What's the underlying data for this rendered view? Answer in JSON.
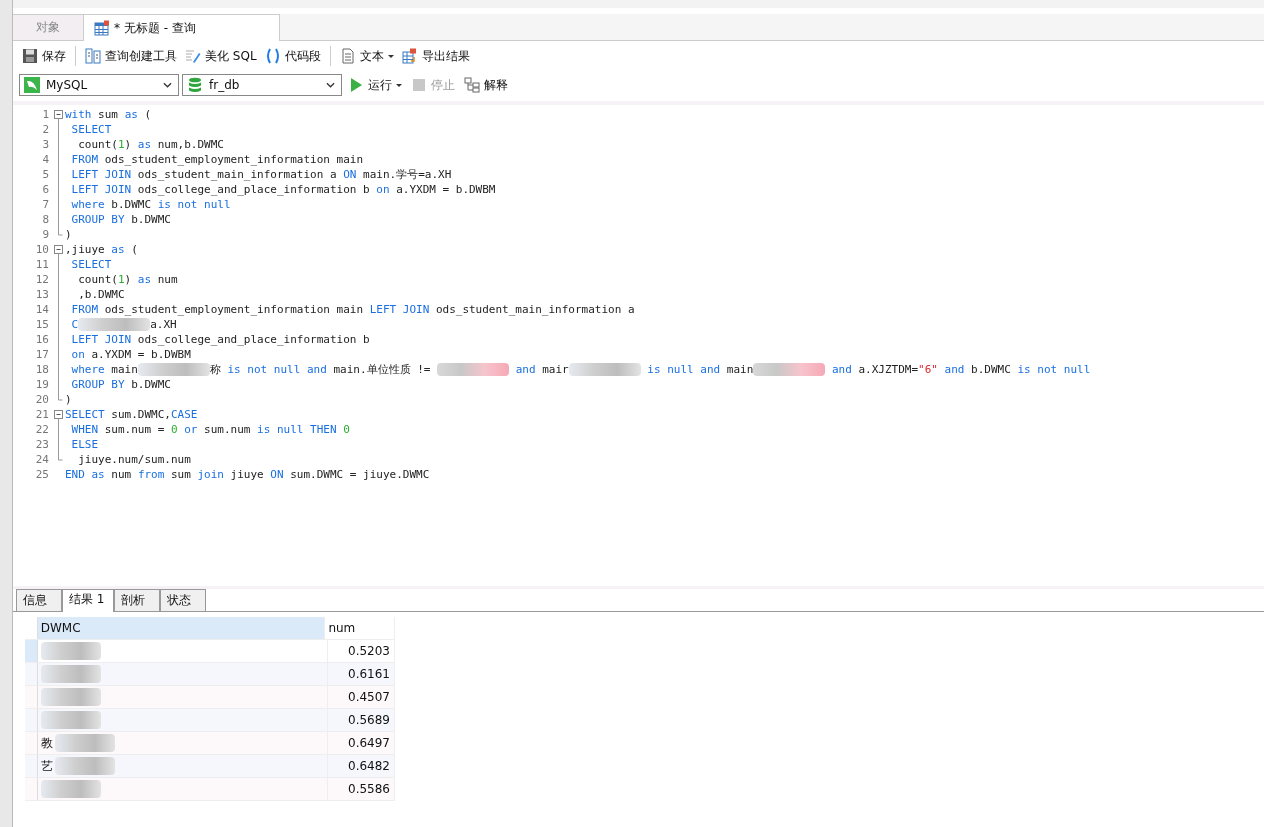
{
  "tabs": [
    {
      "label": "对象",
      "selected": false,
      "kind": "plain"
    },
    {
      "label": "* 无标题 - 查询",
      "selected": true,
      "kind": "query"
    }
  ],
  "toolbar": [
    {
      "label": "保存",
      "kind": "save"
    },
    {
      "label": "查询创建工具",
      "kind": "builder"
    },
    {
      "label": "美化 SQL",
      "kind": "beautify"
    },
    {
      "label": "代码段",
      "kind": "snippet"
    },
    {
      "label": "文本",
      "kind": "text",
      "dropdown": true
    },
    {
      "label": "导出结果",
      "kind": "export"
    }
  ],
  "connection": {
    "value": "MySQL"
  },
  "database": {
    "value": "fr_db"
  },
  "actions": [
    {
      "label": "运行",
      "kind": "run",
      "dropdown": true,
      "disabled": false
    },
    {
      "label": "停止",
      "kind": "stop",
      "disabled": true
    },
    {
      "label": "解释",
      "kind": "explain",
      "disabled": false
    }
  ],
  "code_lines": [
    {
      "number": "1",
      "kind": "fold_start",
      "tokens": [
        {
          "kind": "kw",
          "t": "with"
        },
        {
          "kind": "id",
          "t": " sum "
        },
        {
          "kind": "kw",
          "t": "as"
        },
        {
          "kind": "id",
          "t": " ("
        }
      ]
    },
    {
      "number": "2",
      "tokens": [
        {
          "kind": "kw",
          "t": " SELECT"
        }
      ]
    },
    {
      "number": "3",
      "tokens": [
        {
          "kind": "id",
          "t": "  count("
        },
        {
          "kind": "num",
          "t": "1"
        },
        {
          "kind": "id",
          "t": ") "
        },
        {
          "kind": "kw",
          "t": "as"
        },
        {
          "kind": "id",
          "t": " num,b.DWMC"
        }
      ]
    },
    {
      "number": "4",
      "tokens": [
        {
          "kind": "kw",
          "t": " FROM"
        },
        {
          "kind": "id",
          "t": " ods_student_employment_information main"
        }
      ]
    },
    {
      "number": "5",
      "tokens": [
        {
          "kind": "kw",
          "t": " LEFT JOIN"
        },
        {
          "kind": "id",
          "t": " ods_student_main_information a "
        },
        {
          "kind": "kw",
          "t": "ON"
        },
        {
          "kind": "id",
          "t": " main.学号=a.XH"
        }
      ]
    },
    {
      "number": "6",
      "tokens": [
        {
          "kind": "kw",
          "t": " LEFT JOIN"
        },
        {
          "kind": "id",
          "t": " ods_college_and_place_information b "
        },
        {
          "kind": "kw",
          "t": "on"
        },
        {
          "kind": "id",
          "t": " a.YXDM = b.DWBM"
        }
      ]
    },
    {
      "number": "7",
      "tokens": [
        {
          "kind": "kw",
          "t": " where"
        },
        {
          "kind": "id",
          "t": " b.DWMC "
        },
        {
          "kind": "kw",
          "t": "is not null"
        }
      ]
    },
    {
      "number": "8",
      "tokens": [
        {
          "kind": "kw",
          "t": " GROUP BY"
        },
        {
          "kind": "id",
          "t": " b.DWMC"
        }
      ]
    },
    {
      "number": "9",
      "kind": "fold_end",
      "tokens": [
        {
          "kind": "id",
          "t": ")"
        }
      ]
    },
    {
      "number": "10",
      "kind": "fold_start",
      "tokens": [
        {
          "kind": "id",
          "t": ",jiuye "
        },
        {
          "kind": "kw",
          "t": "as"
        },
        {
          "kind": "id",
          "t": " ("
        }
      ]
    },
    {
      "number": "11",
      "tokens": [
        {
          "kind": "kw",
          "t": " SELECT"
        }
      ]
    },
    {
      "number": "12",
      "tokens": [
        {
          "kind": "id",
          "t": "  count("
        },
        {
          "kind": "num",
          "t": "1"
        },
        {
          "kind": "id",
          "t": ") "
        },
        {
          "kind": "kw",
          "t": "as"
        },
        {
          "kind": "id",
          "t": " num"
        }
      ]
    },
    {
      "number": "13",
      "tokens": [
        {
          "kind": "id",
          "t": "  ,b.DWMC"
        }
      ]
    },
    {
      "number": "14",
      "tokens": [
        {
          "kind": "kw",
          "t": " FROM"
        },
        {
          "kind": "id",
          "t": " ods_student_employment_information main "
        },
        {
          "kind": "kw",
          "t": "LEFT JOIN"
        },
        {
          "kind": "id",
          "t": " ods_student_main_information a"
        }
      ]
    },
    {
      "number": "15",
      "tokens": [
        {
          "kind": "kw",
          "t": " C"
        },
        {
          "kind": "redacted"
        },
        {
          "kind": "id",
          "t": "a.XH"
        }
      ]
    },
    {
      "number": "16",
      "tokens": [
        {
          "kind": "kw",
          "t": " LEFT JOIN"
        },
        {
          "kind": "id",
          "t": " ods_college_and_place_information b"
        }
      ]
    },
    {
      "number": "17",
      "tokens": [
        {
          "kind": "kw",
          "t": " on"
        },
        {
          "kind": "id",
          "t": " a.YXDM = b.DWBM"
        }
      ]
    },
    {
      "number": "18",
      "tokens": [
        {
          "kind": "kw",
          "t": " where"
        },
        {
          "kind": "id",
          "t": " main"
        },
        {
          "kind": "redacted"
        },
        {
          "kind": "id",
          "t": "称 "
        },
        {
          "kind": "kw",
          "t": "is not null and"
        },
        {
          "kind": "id",
          "t": " main.单位性质 != "
        },
        {
          "kind": "redacted_pink"
        },
        {
          "kind": "kw",
          "t": " and"
        },
        {
          "kind": "id",
          "t": " mair"
        },
        {
          "kind": "redacted"
        },
        {
          "kind": "kw",
          "t": " is null and"
        },
        {
          "kind": "id",
          "t": " main"
        },
        {
          "kind": "redacted_pink"
        },
        {
          "kind": "kw",
          "t": " and"
        },
        {
          "kind": "id",
          "t": " a.XJZTDM="
        },
        {
          "kind": "str",
          "t": "\"6\""
        },
        {
          "kind": "kw",
          "t": " and"
        },
        {
          "kind": "id",
          "t": " b.DWMC "
        },
        {
          "kind": "kw",
          "t": "is not null"
        }
      ]
    },
    {
      "number": "19",
      "tokens": [
        {
          "kind": "kw",
          "t": " GROUP BY"
        },
        {
          "kind": "id",
          "t": " b.DWMC"
        }
      ]
    },
    {
      "number": "20",
      "kind": "fold_end",
      "tokens": [
        {
          "kind": "id",
          "t": ")"
        }
      ]
    },
    {
      "number": "21",
      "kind": "fold_start",
      "tokens": [
        {
          "kind": "kw",
          "t": "SELECT"
        },
        {
          "kind": "id",
          "t": " sum.DWMC,"
        },
        {
          "kind": "kw",
          "t": "CASE"
        }
      ]
    },
    {
      "number": "22",
      "tokens": [
        {
          "kind": "kw",
          "t": " WHEN"
        },
        {
          "kind": "id",
          "t": " sum.num = "
        },
        {
          "kind": "num",
          "t": "0"
        },
        {
          "kind": "kw",
          "t": " or"
        },
        {
          "kind": "id",
          "t": " sum.num "
        },
        {
          "kind": "kw",
          "t": "is null THEN"
        },
        {
          "kind": "num",
          "t": " 0"
        }
      ]
    },
    {
      "number": "23",
      "tokens": [
        {
          "kind": "kw",
          "t": " ELSE"
        }
      ]
    },
    {
      "number": "24",
      "kind": "fold_end",
      "tokens": [
        {
          "kind": "id",
          "t": "  jiuye.num/sum.num"
        }
      ]
    },
    {
      "number": "25",
      "tokens": [
        {
          "kind": "kw",
          "t": "END as"
        },
        {
          "kind": "id",
          "t": " num "
        },
        {
          "kind": "kw",
          "t": "from"
        },
        {
          "kind": "id",
          "t": " sum "
        },
        {
          "kind": "kw",
          "t": "join"
        },
        {
          "kind": "id",
          "t": " jiuye "
        },
        {
          "kind": "kw",
          "t": "ON"
        },
        {
          "kind": "id",
          "t": " sum.DWMC = jiuye.DWMC"
        }
      ]
    }
  ],
  "result_tabs": [
    {
      "label": "信息",
      "selected": false
    },
    {
      "label": "结果 1",
      "selected": true
    },
    {
      "label": "剖析",
      "selected": false
    },
    {
      "label": "状态",
      "selected": false
    }
  ],
  "table": {
    "columns": [
      "DWMC",
      "num"
    ],
    "rows": [
      {
        "num": "0.5203",
        "selected": true
      },
      {
        "num": "0.6161",
        "selected": false
      },
      {
        "num": "0.4507",
        "selected": false
      },
      {
        "num": "0.5689",
        "selected": false
      },
      {
        "dwmc": "教",
        "num": "0.6497",
        "selected": false
      },
      {
        "dwmc": "艺",
        "num": "0.6482",
        "selected": false
      },
      {
        "num": "0.5586",
        "selected": false
      }
    ]
  }
}
